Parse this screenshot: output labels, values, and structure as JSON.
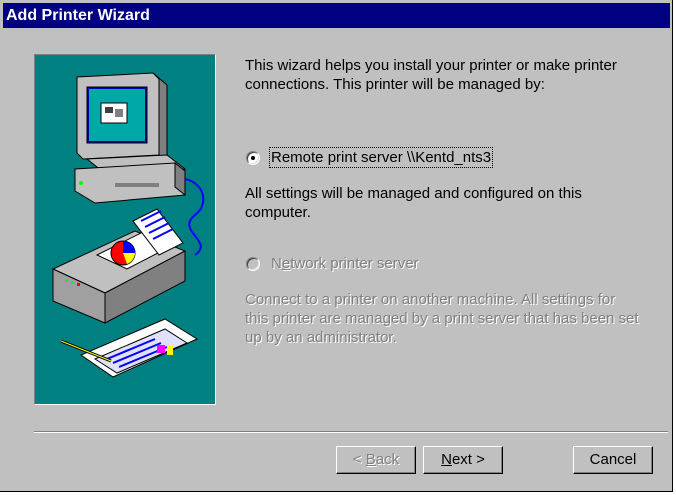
{
  "window": {
    "title": "Add Printer Wizard"
  },
  "intro": {
    "line1": "This wizard helps you install your printer or make printer",
    "line2": "connections.  This printer will be managed by:"
  },
  "option_remote": {
    "label": "Remote print server \\\\Kentd_nts3",
    "selected": true,
    "desc_line1": "All settings will be managed and configured on this",
    "desc_line2": "computer."
  },
  "option_network": {
    "label_first": "N",
    "label_accel": "e",
    "label_rest": "twork printer server",
    "selected": false,
    "enabled": false,
    "desc_line1": "Connect to a printer on another machine.  All settings for",
    "desc_line2": "this printer are managed by a print server that has been set",
    "desc_line3": "up by an administrator."
  },
  "buttons": {
    "back_accel": "B",
    "back_prefix": "< ",
    "back_rest": "ack",
    "next_accel": "N",
    "next_rest": "ext >",
    "cancel": "Cancel"
  },
  "colors": {
    "titlebar": "#000080",
    "face": "#c0c0c0",
    "art_background": "#008080"
  },
  "icons": [
    "computer-icon",
    "printer-icon",
    "documents-icon"
  ]
}
